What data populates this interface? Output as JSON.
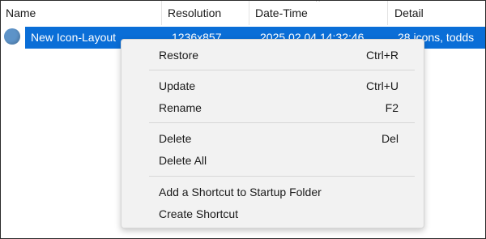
{
  "columns": [
    {
      "label": "Name"
    },
    {
      "label": "Resolution"
    },
    {
      "label": "Date-Time"
    },
    {
      "label": "Detail"
    }
  ],
  "sort_indicator": "^",
  "row": {
    "icon": "circle-icon",
    "name": "New Icon-Layout",
    "resolution": "1236x857",
    "datetime": "2025.02.04 14:32:46",
    "detail": "28 icons, todds"
  },
  "menu": {
    "restore": {
      "label": "Restore",
      "shortcut": "Ctrl+R"
    },
    "update": {
      "label": "Update",
      "shortcut": "Ctrl+U"
    },
    "rename": {
      "label": "Rename",
      "shortcut": "F2"
    },
    "delete": {
      "label": "Delete",
      "shortcut": "Del"
    },
    "delete_all": {
      "label": "Delete All"
    },
    "add_shortcut": {
      "label": "Add a Shortcut to Startup Folder"
    },
    "create_shortcut": {
      "label": "Create Shortcut"
    }
  },
  "colors": {
    "selection": "#0a6ed7",
    "menu_bg": "#f2f2f2",
    "icon": "#5d93c8"
  }
}
